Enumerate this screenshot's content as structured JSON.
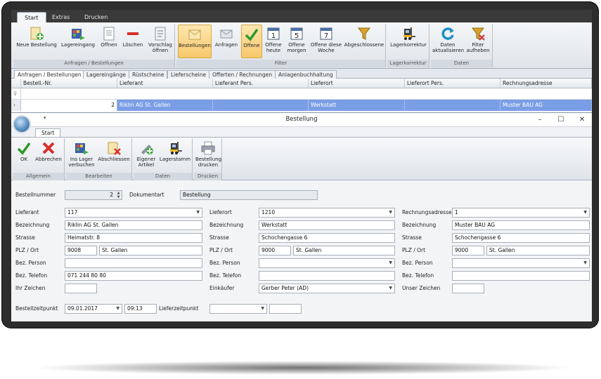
{
  "main_ribbon": {
    "tabs": [
      "Start",
      "Extras",
      "Drucken"
    ],
    "groups": [
      {
        "label": "Anfragen / Bestellungen",
        "buttons": [
          {
            "label": "Neue Bestellung",
            "icon": "new-order-icon"
          },
          {
            "label": "Lagereingang",
            "icon": "warehouse-in-icon"
          },
          {
            "label": "Offnen",
            "icon": "open-doc-icon"
          },
          {
            "label": "Löschen",
            "icon": "delete-icon"
          },
          {
            "label": "Vorschlag öffnen",
            "icon": "proposal-icon"
          }
        ]
      },
      {
        "label": "Filter",
        "buttons": [
          {
            "label": "Bestellungen",
            "icon": "orders-icon",
            "selected": true
          },
          {
            "label": "Anfragen",
            "icon": "envelope-icon"
          },
          {
            "label": "Offene",
            "icon": "checkmark-icon",
            "selected": true
          },
          {
            "label": "Offene heute",
            "icon": "calendar-1-icon"
          },
          {
            "label": "Offene morgen",
            "icon": "calendar-5-icon"
          },
          {
            "label": "Offene diese Woche",
            "icon": "calendar-7-icon"
          },
          {
            "label": "Abgeschlossene",
            "icon": "funnel-icon"
          }
        ]
      },
      {
        "label": "Lagerkorrektur",
        "buttons": [
          {
            "label": "Lagerkorrektur",
            "icon": "forklift-icon"
          }
        ]
      },
      {
        "label": "Daten",
        "buttons": [
          {
            "label": "Daten aktualisieren",
            "icon": "refresh-icon"
          },
          {
            "label": "Filter aufheben",
            "icon": "filter-remove-icon"
          }
        ]
      }
    ]
  },
  "subtabs": [
    "Anfragen / Bestellungen",
    "Lagereingänge",
    "Rüstscheine",
    "Lieferscheine",
    "Offerten / Rechnungen",
    "Anlagenbuchhaltung"
  ],
  "grid": {
    "columns": [
      "Bestell.-Nr.",
      "Lieferant",
      "Lieferant Pers.",
      "Lieferort",
      "Lieferort Pers.",
      "Rechnungsadresse"
    ],
    "rows": [
      {
        "nr": "2",
        "lieferant": "Riklin AG St. Gallen",
        "lieferant_pers": "",
        "lieferort": "Werkstatt",
        "lieferort_pers": "",
        "rechnungsadresse": "Muster BAU AG"
      }
    ]
  },
  "dialog": {
    "title": "Bestellung",
    "tab": "Start",
    "groups": [
      {
        "label": "Allgemein",
        "buttons": [
          {
            "label": "OK",
            "icon": "ok-check-icon"
          },
          {
            "label": "Abbrechen",
            "icon": "cancel-x-icon"
          }
        ]
      },
      {
        "label": "Bearbeiten",
        "buttons": [
          {
            "label": "Ins Lager verbuchen",
            "icon": "book-to-stock-icon"
          },
          {
            "label": "Abschliessen",
            "icon": "close-order-icon"
          }
        ]
      },
      {
        "label": "Daten",
        "buttons": [
          {
            "label": "Eigener Artikel",
            "icon": "own-article-icon"
          },
          {
            "label": "Lagerstamm",
            "icon": "forklift-icon"
          }
        ]
      },
      {
        "label": "Drucken",
        "buttons": [
          {
            "label": "Bestellung drucken",
            "icon": "printer-icon"
          }
        ]
      }
    ]
  },
  "form": {
    "bestellnummer_label": "Bestellnummer",
    "bestellnummer": "2",
    "dokumentart_label": "Dokumentart",
    "dokumentart": "Bestellung",
    "col1": {
      "lieferant_label": "Lieferant",
      "lieferant": "117",
      "bezeichnung_label": "Bezeichnung",
      "bezeichnung": "Riklin AG St. Gallen",
      "strasse_label": "Strasse",
      "strasse": "Heimatstr. 8",
      "plz_label": "PLZ / Ort",
      "plz": "9008",
      "ort": "St. Gallen",
      "person_label": "Bez. Person",
      "person": "",
      "telefon_label": "Bez. Telefon",
      "telefon": "071 244 80 80",
      "zeichen_label": "Ihr Zeichen",
      "zeichen": ""
    },
    "col2": {
      "lieferort_label": "Lieferort",
      "lieferort": "1210",
      "bezeichnung_label": "Bezeichnung",
      "bezeichnung": "Werkstatt",
      "strasse_label": "Strasse",
      "strasse": "Schochengasse 6",
      "plz_label": "PLZ / Ort",
      "plz": "9000",
      "ort": "St. Gallen",
      "person_label": "Bez. Person",
      "person": "",
      "telefon_label": "Bez. Telefon",
      "telefon": "",
      "einkaeufer_label": "Einkäufer",
      "einkaeufer": "Gerber Peter (AD)"
    },
    "col3": {
      "rechnungsadresse_label": "Rechnungsadresse",
      "rechnungsadresse": "1",
      "bezeichnung_label": "Bezeichnung",
      "bezeichnung": "Muster BAU AG",
      "strasse_label": "Strasse",
      "strasse": "Schochengasse 6",
      "plz_label": "PLZ / Ort",
      "plz": "9000",
      "ort": "St. Gallen",
      "person_label": "Bez. Person",
      "person": "",
      "telefon_label": "Bez. Telefon",
      "telefon": "",
      "zeichen_label": "Unser Zeichen",
      "zeichen": ""
    },
    "bestellzeitpunkt_label": "Bestellzeitpunkt",
    "bestell_datum": "09.01.2017",
    "bestell_zeit": "09:13",
    "lieferzeitpunkt_label": "Lieferzeitpunkt",
    "liefer_datum": "",
    "liefer_zeit": ""
  },
  "colors": {
    "selection": "#7a9ee6",
    "ribbon_selected": "#f8c86b",
    "bezel": "#2d2d2d"
  }
}
